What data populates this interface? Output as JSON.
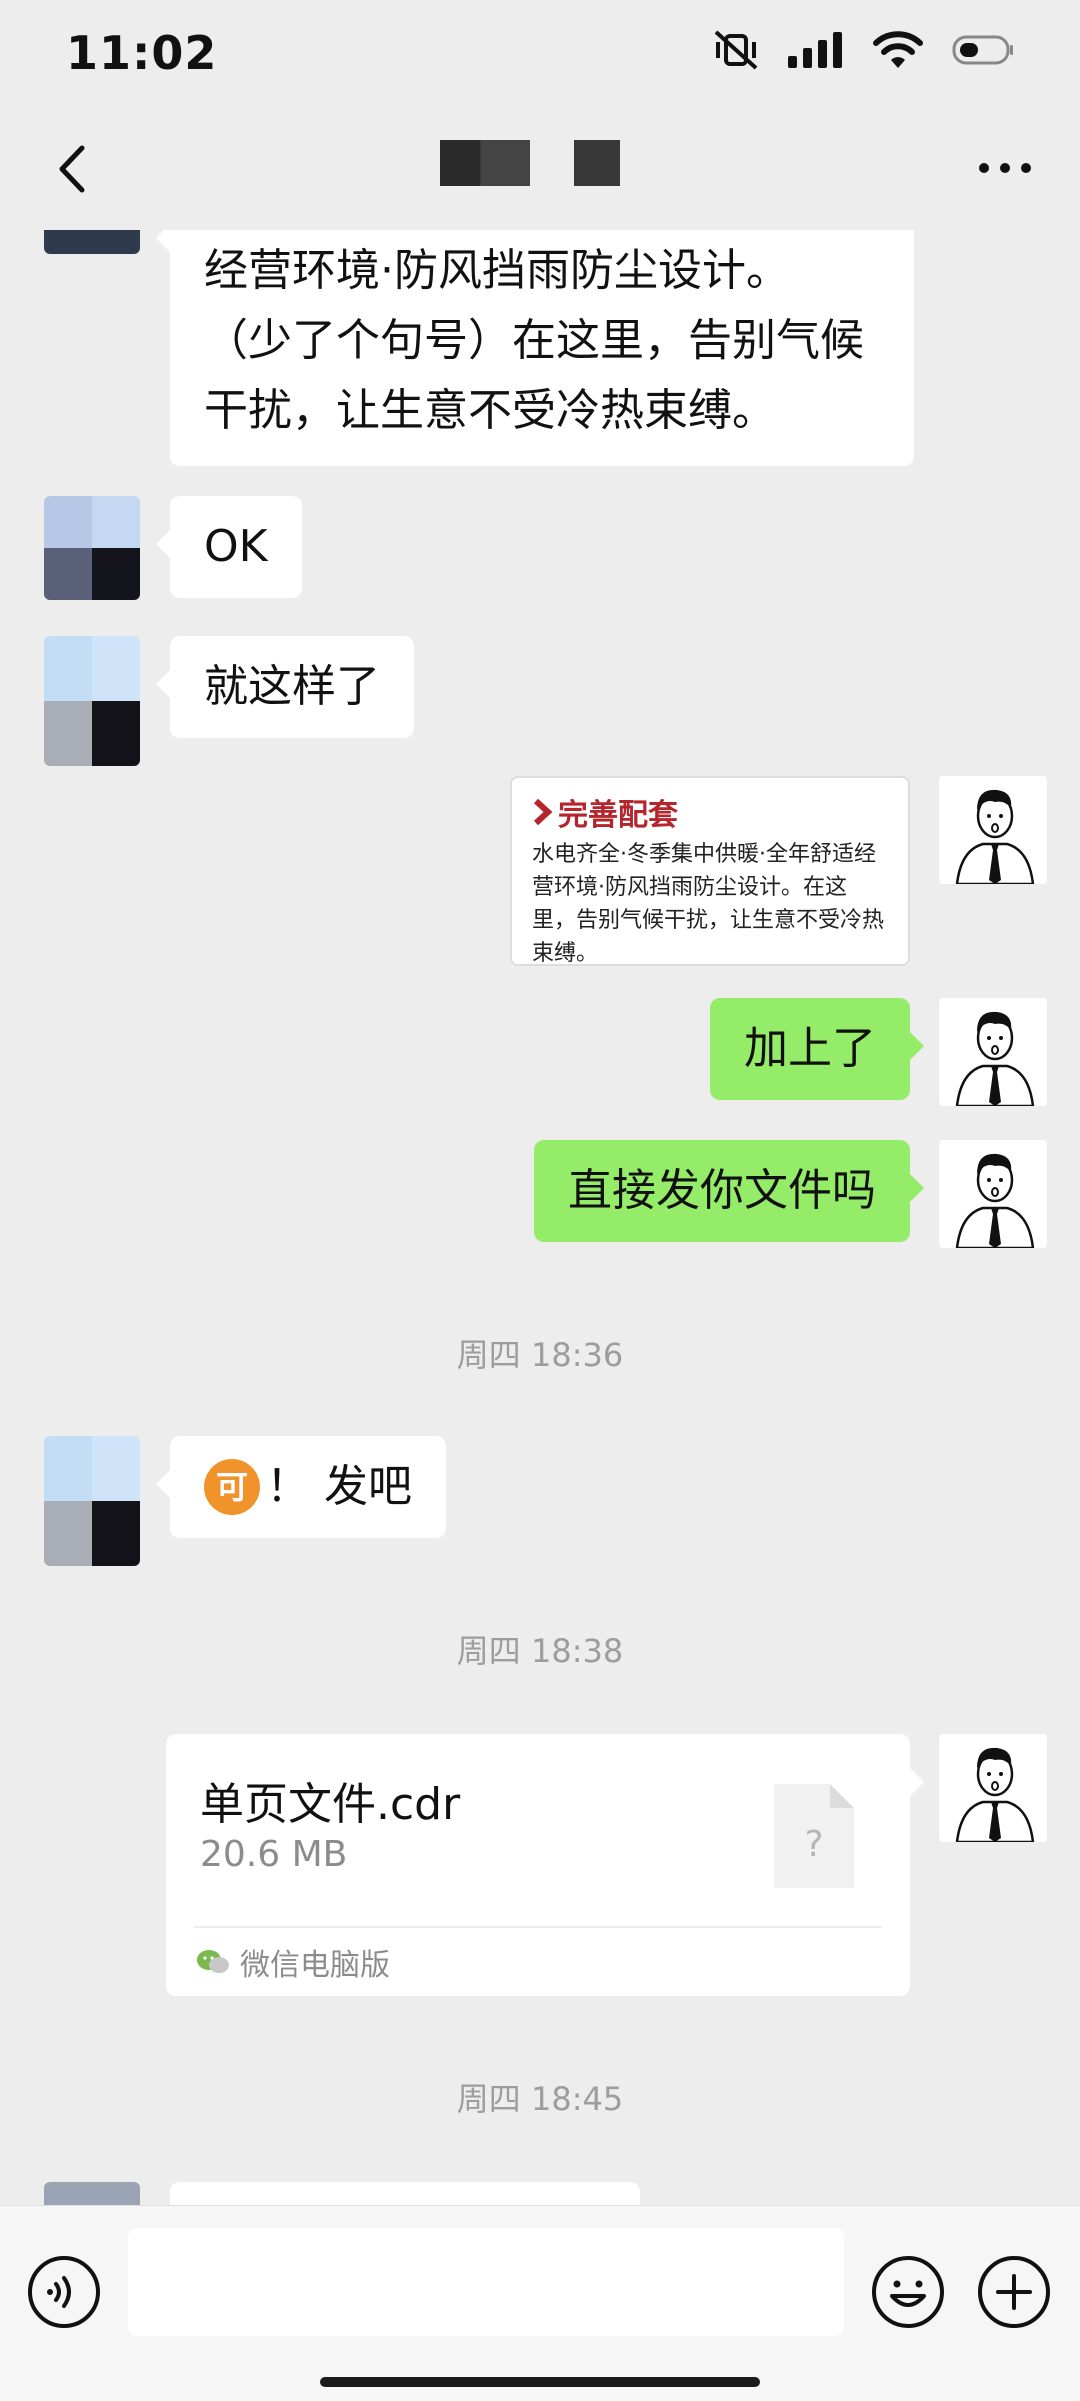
{
  "status_bar": {
    "time": "11:02",
    "icons": [
      "mute-vibrate-icon",
      "signal-icon",
      "wifi-icon",
      "battery-icon"
    ]
  },
  "nav": {
    "back_icon": "chevron-left-icon",
    "more_icon": "more-dots-icon"
  },
  "messages": [
    {
      "id": "m1",
      "side": "in",
      "lines": [
        "经营环境·防风挡雨防尘设计。",
        "（少了个句号）在这里，告别气候",
        "干扰，让生意不受冷热束缚。"
      ]
    },
    {
      "id": "m2",
      "side": "in",
      "text": "OK"
    },
    {
      "id": "m3",
      "side": "in",
      "text": "就这样了"
    },
    {
      "id": "m4",
      "side": "out",
      "type": "image",
      "card_title": "完善配套",
      "card_body": "水电齐全·冬季集中供暖·全年舒适经营环境·防风挡雨防尘设计。在这里，告别气候干扰，让生意不受冷热束缚。"
    },
    {
      "id": "m5",
      "side": "out",
      "text": "加上了"
    },
    {
      "id": "m6",
      "side": "out",
      "text": "直接发你文件吗"
    },
    {
      "id": "t1",
      "type": "time",
      "text": "周四 18:36"
    },
    {
      "id": "m7",
      "side": "in",
      "emoji_char": "可",
      "text": "！ 发吧"
    },
    {
      "id": "t2",
      "type": "time",
      "text": "周四 18:38"
    },
    {
      "id": "m8",
      "side": "out",
      "type": "file",
      "file_name": "单页文件.cdr",
      "file_size": "20.6 MB",
      "file_icon_glyph": "?",
      "source": "微信电脑版"
    },
    {
      "id": "t3",
      "type": "time",
      "text": "周四 18:45"
    }
  ],
  "input_bar": {
    "placeholder": "",
    "voice_icon": "voice-icon",
    "emoji_icon": "emoji-icon",
    "plus_icon": "plus-icon"
  },
  "colors": {
    "background": "#ededed",
    "bubble_out": "#95ec69",
    "bubble_in": "#ffffff",
    "timestamp": "#9d9d9d",
    "card_title_red": "#b5262c"
  }
}
